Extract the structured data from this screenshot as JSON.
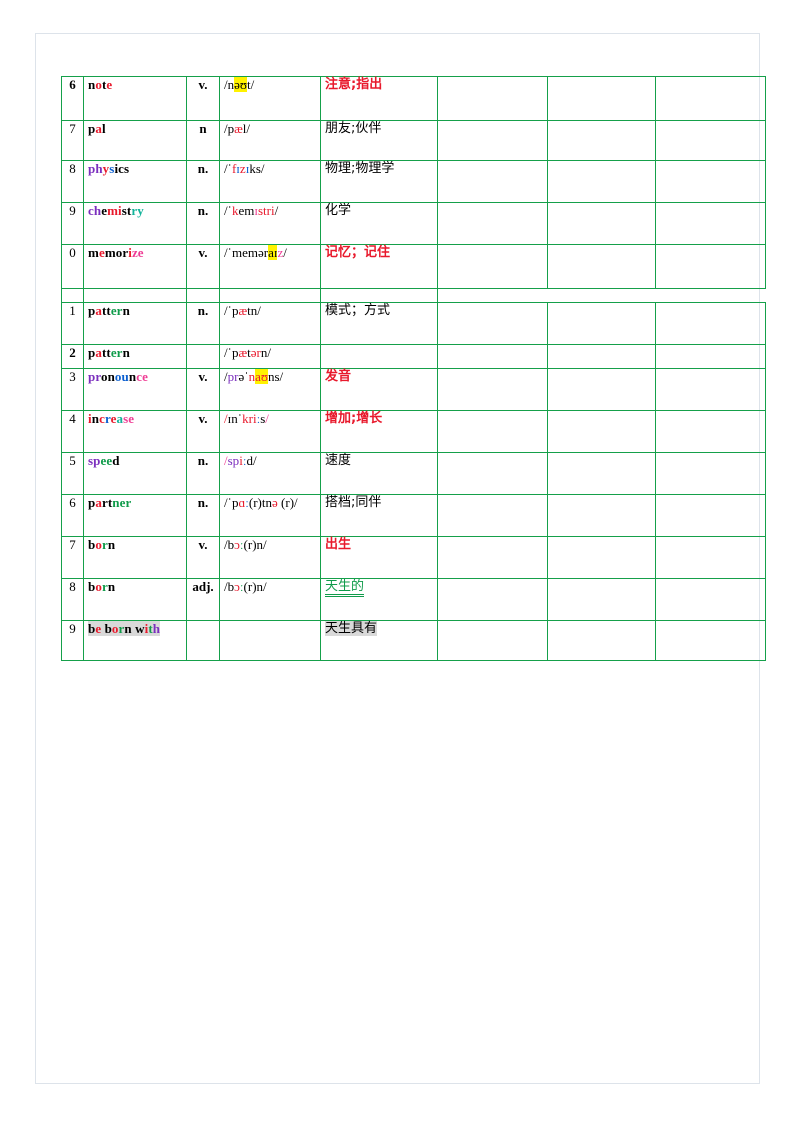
{
  "document": {
    "kind": "vocabulary-worksheet",
    "colors": {
      "table_border": "#15a04a",
      "page_border": "#dde3ea",
      "accent_red": "#e8192c",
      "accent_purple": "#7b2fbe",
      "accent_blue": "#0b5fd0",
      "accent_green": "#0f9b4a",
      "accent_teal": "#12b39a",
      "accent_magenta": "#ef3d95",
      "highlight_yellow": "#fff200",
      "highlight_gray": "#d9d9d9"
    }
  },
  "table": {
    "columns": [
      "number",
      "word",
      "part_of_speech",
      "phonetic",
      "meaning",
      "blank1",
      "blank2",
      "blank3"
    ],
    "block1": [
      {
        "number": "6",
        "number_bold": true,
        "word": "note",
        "word_letters": [
          {
            "t": "n",
            "c": "k"
          },
          {
            "t": "o",
            "c": "r"
          },
          {
            "t": "t",
            "c": "k"
          },
          {
            "t": "e",
            "c": "r"
          }
        ],
        "pos": "v.",
        "pos_color": "r",
        "phonetic": "/nəʊt/",
        "phonetic_parts": [
          {
            "t": "/n",
            "c": "k"
          },
          {
            "t": "əʊ",
            "c": "k",
            "hl": true
          },
          {
            "t": "t/",
            "c": "k"
          }
        ],
        "meaning": "注意;指出",
        "meaning_style": "red"
      },
      {
        "number": "7",
        "number_bold": false,
        "word": "pal",
        "word_letters": [
          {
            "t": "p",
            "c": "k"
          },
          {
            "t": "a",
            "c": "r"
          },
          {
            "t": "l",
            "c": "k"
          }
        ],
        "pos": "n",
        "pos_color": "k",
        "phonetic": "/pæl/",
        "phonetic_parts": [
          {
            "t": "/p",
            "c": "k"
          },
          {
            "t": "æ",
            "c": "r"
          },
          {
            "t": "l/",
            "c": "k"
          }
        ],
        "meaning": "朋友;伙伴",
        "meaning_style": "black"
      },
      {
        "number": "8",
        "number_bold": false,
        "word": "physics",
        "word_letters": [
          {
            "t": "ph",
            "c": "p"
          },
          {
            "t": "y",
            "c": "r"
          },
          {
            "t": "s",
            "c": "b"
          },
          {
            "t": "ics",
            "c": "k"
          }
        ],
        "pos": "n.",
        "pos_color": "k",
        "phonetic": "/ˈfɪzɪks/",
        "phonetic_parts": [
          {
            "t": "/ˈ",
            "c": "k"
          },
          {
            "t": "f",
            "c": "r"
          },
          {
            "t": "ɪ",
            "c": "b"
          },
          {
            "t": "z",
            "c": "r"
          },
          {
            "t": "ɪ",
            "c": "b"
          },
          {
            "t": "ks/",
            "c": "k"
          }
        ],
        "meaning": "物理;物理学",
        "meaning_style": "black"
      },
      {
        "number": "9",
        "number_bold": false,
        "word": "chemistry",
        "word_letters": [
          {
            "t": "ch",
            "c": "p"
          },
          {
            "t": "e",
            "c": "k"
          },
          {
            "t": "mi",
            "c": "r"
          },
          {
            "t": "st",
            "c": "k"
          },
          {
            "t": "ry",
            "c": "t"
          }
        ],
        "pos": "n.",
        "pos_color": "k",
        "phonetic": "/ˈkemɪstri/",
        "phonetic_parts": [
          {
            "t": "/ˈ",
            "c": "k"
          },
          {
            "t": "k",
            "c": "r"
          },
          {
            "t": "em",
            "c": "k"
          },
          {
            "t": "ɪ",
            "c": "m"
          },
          {
            "t": "stri",
            "c": "r"
          },
          {
            "t": "/",
            "c": "k"
          }
        ],
        "meaning": "化学",
        "meaning_style": "black"
      },
      {
        "number": "0",
        "number_bold": false,
        "word": "memorize",
        "word_letters": [
          {
            "t": "m",
            "c": "k"
          },
          {
            "t": "e",
            "c": "r"
          },
          {
            "t": "mor",
            "c": "k"
          },
          {
            "t": "i",
            "c": "r"
          },
          {
            "t": "ze",
            "c": "m"
          }
        ],
        "pos": "v.",
        "pos_color": "r",
        "phonetic": "/ˈmeməraɪz/",
        "phonetic_parts": [
          {
            "t": "/ˈ",
            "c": "k"
          },
          {
            "t": "mem",
            "c": "k"
          },
          {
            "t": "ə",
            "c": "k"
          },
          {
            "t": "r",
            "c": "k"
          },
          {
            "t": "aɪ",
            "c": "k",
            "hl": true
          },
          {
            "t": "z",
            "c": "m"
          },
          {
            "t": "/",
            "c": "k"
          }
        ],
        "meaning": "记忆；记住",
        "meaning_style": "red"
      }
    ],
    "block2": [
      {
        "number": "1",
        "number_bold": false,
        "word": "pattern",
        "word_letters": [
          {
            "t": "p",
            "c": "k"
          },
          {
            "t": "a",
            "c": "r"
          },
          {
            "t": "tt",
            "c": "k"
          },
          {
            "t": "er",
            "c": "g"
          },
          {
            "t": "n",
            "c": "k"
          }
        ],
        "pos": "n.",
        "pos_color": "k",
        "phonetic": "/ˈpætn/",
        "phonetic_parts": [
          {
            "t": "/ˈ",
            "c": "k"
          },
          {
            "t": "p",
            "c": "k"
          },
          {
            "t": "æ",
            "c": "r"
          },
          {
            "t": "tn/",
            "c": "k"
          }
        ],
        "meaning": "模式；方式",
        "meaning_style": "black"
      },
      {
        "number": "2",
        "number_bold": true,
        "word": "pattern",
        "word_letters": [
          {
            "t": "p",
            "c": "k"
          },
          {
            "t": "a",
            "c": "r"
          },
          {
            "t": "tt",
            "c": "k"
          },
          {
            "t": "er",
            "c": "g"
          },
          {
            "t": "n",
            "c": "k"
          }
        ],
        "pos": "",
        "pos_color": "k",
        "phonetic": "/ˈpætərn/",
        "phonetic_parts": [
          {
            "t": "/ˈ",
            "c": "k"
          },
          {
            "t": "p",
            "c": "k"
          },
          {
            "t": "æ",
            "c": "r"
          },
          {
            "t": "t",
            "c": "k"
          },
          {
            "t": "ər",
            "c": "r"
          },
          {
            "t": "n/",
            "c": "k"
          }
        ],
        "meaning": "",
        "meaning_style": "black"
      },
      {
        "number": "3",
        "number_bold": false,
        "word": "pronounce",
        "word_letters": [
          {
            "t": "pr",
            "c": "p"
          },
          {
            "t": "o",
            "c": "k"
          },
          {
            "t": "n",
            "c": "k"
          },
          {
            "t": "ou",
            "c": "b"
          },
          {
            "t": "n",
            "c": "k"
          },
          {
            "t": "ce",
            "c": "m"
          }
        ],
        "pos": "v.",
        "pos_color": "r",
        "phonetic": "/prəˈnaʊns/",
        "phonetic_parts": [
          {
            "t": "/",
            "c": "k"
          },
          {
            "t": "pr",
            "c": "p"
          },
          {
            "t": "ə",
            "c": "k"
          },
          {
            "t": "ˈ",
            "c": "k"
          },
          {
            "t": "n",
            "c": "r"
          },
          {
            "t": "aʊ",
            "c": "r",
            "hl": true
          },
          {
            "t": "ns/",
            "c": "k"
          }
        ],
        "meaning": "发音",
        "meaning_style": "red"
      },
      {
        "number": "4",
        "number_bold": false,
        "word": "increase",
        "word_letters": [
          {
            "t": "i",
            "c": "r"
          },
          {
            "t": "n",
            "c": "k"
          },
          {
            "t": "c",
            "c": "r"
          },
          {
            "t": "r",
            "c": "b"
          },
          {
            "t": "e",
            "c": "r"
          },
          {
            "t": "a",
            "c": "t"
          },
          {
            "t": "se",
            "c": "m"
          }
        ],
        "pos": "v.",
        "pos_color": "r",
        "phonetic": "/ɪnˈkriːs/",
        "phonetic_parts": [
          {
            "t": "/",
            "c": "r"
          },
          {
            "t": "ɪn",
            "c": "k"
          },
          {
            "t": "ˈ",
            "c": "k"
          },
          {
            "t": "kr",
            "c": "r"
          },
          {
            "t": "i",
            "c": "r"
          },
          {
            "t": "ː",
            "c": "b"
          },
          {
            "t": "s",
            "c": "k"
          },
          {
            "t": "/",
            "c": "m"
          }
        ],
        "meaning": "增加;增长",
        "meaning_style": "red"
      },
      {
        "number": "5",
        "number_bold": false,
        "word": "speed",
        "word_letters": [
          {
            "t": "sp",
            "c": "p"
          },
          {
            "t": "ee",
            "c": "g"
          },
          {
            "t": "d",
            "c": "k"
          }
        ],
        "pos": "n.",
        "pos_color": "k",
        "phonetic": "/spiːd/",
        "phonetic_parts": [
          {
            "t": "/",
            "c": "m"
          },
          {
            "t": "sp",
            "c": "p"
          },
          {
            "t": "i",
            "c": "r"
          },
          {
            "t": "ː",
            "c": "b"
          },
          {
            "t": "d/",
            "c": "k"
          }
        ],
        "meaning": "速度",
        "meaning_style": "black"
      },
      {
        "number": "6",
        "number_bold": false,
        "word": "partner",
        "word_letters": [
          {
            "t": "p",
            "c": "k"
          },
          {
            "t": "a",
            "c": "r"
          },
          {
            "t": "rt",
            "c": "k"
          },
          {
            "t": "ner",
            "c": "g"
          }
        ],
        "pos": "n.",
        "pos_color": "k",
        "phonetic": "/ˈpɑː(r)tnə(r)/",
        "phonetic_parts": [
          {
            "t": "/ˈ",
            "c": "k"
          },
          {
            "t": "p",
            "c": "k"
          },
          {
            "t": "ɑ",
            "c": "r"
          },
          {
            "t": "ː",
            "c": "b"
          },
          {
            "t": "(r)tn",
            "c": "k"
          },
          {
            "t": "ə",
            "c": "r"
          },
          {
            "t": " (r)/",
            "c": "k"
          }
        ],
        "meaning": "搭档;同伴",
        "meaning_style": "black"
      },
      {
        "number": "7",
        "number_bold": false,
        "word": "born",
        "word_letters": [
          {
            "t": "b",
            "c": "k"
          },
          {
            "t": "o",
            "c": "r"
          },
          {
            "t": "r",
            "c": "g"
          },
          {
            "t": "n",
            "c": "k"
          }
        ],
        "pos": "v.",
        "pos_color": "r",
        "phonetic": "/bɔː(r)n/",
        "phonetic_parts": [
          {
            "t": "/b",
            "c": "k"
          },
          {
            "t": "ɔ",
            "c": "r"
          },
          {
            "t": "ː",
            "c": "g"
          },
          {
            "t": "(r)n/",
            "c": "k"
          }
        ],
        "meaning": "出生",
        "meaning_style": "red"
      },
      {
        "number": "8",
        "number_bold": false,
        "word": "born",
        "word_letters": [
          {
            "t": "b",
            "c": "k"
          },
          {
            "t": "o",
            "c": "r"
          },
          {
            "t": "r",
            "c": "g"
          },
          {
            "t": "n",
            "c": "k"
          }
        ],
        "pos": "adj.",
        "pos_color": "g",
        "phonetic": "/bɔː(r)n/",
        "phonetic_parts": [
          {
            "t": "/b",
            "c": "k"
          },
          {
            "t": "ɔ",
            "c": "r"
          },
          {
            "t": "ː",
            "c": "g"
          },
          {
            "t": "(r)n/",
            "c": "k"
          }
        ],
        "meaning": "天生的",
        "meaning_style": "green-double-underline"
      },
      {
        "number": "9",
        "number_bold": false,
        "word": "be born with",
        "word_highlight": "gray",
        "word_letters": [
          {
            "t": "b",
            "c": "k"
          },
          {
            "t": "e",
            "c": "r"
          },
          {
            "t": " ",
            "c": "k"
          },
          {
            "t": "b",
            "c": "k"
          },
          {
            "t": "o",
            "c": "r"
          },
          {
            "t": "r",
            "c": "g"
          },
          {
            "t": "n",
            "c": "k"
          },
          {
            "t": " ",
            "c": "k"
          },
          {
            "t": "w",
            "c": "k"
          },
          {
            "t": "i",
            "c": "r"
          },
          {
            "t": "t",
            "c": "g"
          },
          {
            "t": "h",
            "c": "p"
          }
        ],
        "pos": "",
        "pos_color": "k",
        "phonetic": "",
        "phonetic_parts": [],
        "meaning": "天生具有",
        "meaning_style": "black-gray-highlight"
      }
    ]
  }
}
